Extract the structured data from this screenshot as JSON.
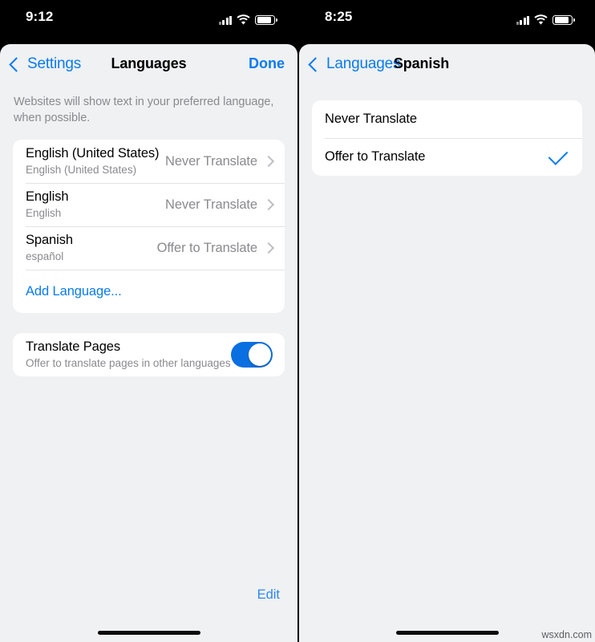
{
  "left_screen": {
    "status_bar": {
      "time": "9:12",
      "cellular_icon": "cellular-signal-icon",
      "wifi_icon": "wifi-icon",
      "battery_icon": "battery-icon"
    },
    "nav": {
      "back_label": "Settings",
      "back_icon": "chevron-left-icon",
      "title": "Languages",
      "action_label": "Done"
    },
    "description": "Websites will show text in your preferred language, when possible.",
    "language_rows": [
      {
        "title": "English (United States)",
        "subtitle": "English (United States)",
        "value": "Never Translate",
        "accessory": "chevron-right-icon"
      },
      {
        "title": "English",
        "subtitle": "English",
        "value": "Never Translate",
        "accessory": "chevron-right-icon"
      },
      {
        "title": "Spanish",
        "subtitle": "español",
        "value": "Offer to Translate",
        "accessory": "chevron-right-icon"
      }
    ],
    "add_language_label": "Add Language...",
    "translate_pages": {
      "title": "Translate Pages",
      "subtitle": "Offer to translate pages in other languages",
      "toggle_state": "on"
    },
    "edit_label": "Edit"
  },
  "right_screen": {
    "status_bar": {
      "time": "8:25",
      "cellular_icon": "cellular-signal-icon",
      "wifi_icon": "wifi-icon",
      "battery_icon": "battery-icon"
    },
    "nav": {
      "back_label": "Languages",
      "back_icon": "chevron-left-icon",
      "title": "Spanish"
    },
    "options": [
      {
        "label": "Never Translate",
        "selected": false
      },
      {
        "label": "Offer to Translate",
        "selected": true
      }
    ]
  },
  "watermark": "wsxdn.com",
  "colors": {
    "accent_blue": "#0a7bf0",
    "toggle_on": "#0a6fe0",
    "sheet_bg": "#eff1f2",
    "card_bg": "#ffffff",
    "secondary_text": "#8a8a8e"
  }
}
